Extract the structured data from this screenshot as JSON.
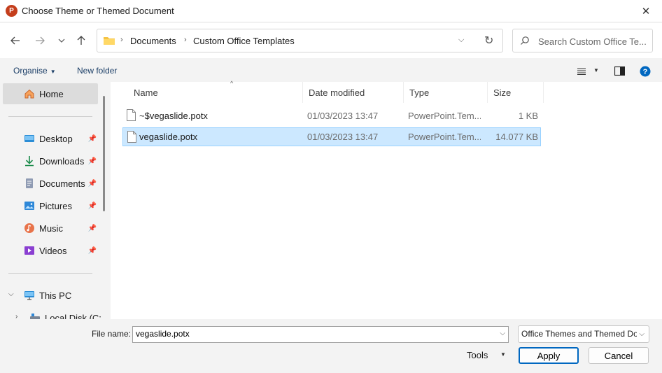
{
  "window": {
    "title": "Choose Theme or Themed Document",
    "app_icon_letter": "P",
    "close_glyph": "✕"
  },
  "address": {
    "crumbs": [
      "Documents",
      "Custom Office Templates"
    ]
  },
  "search": {
    "placeholder": "Search Custom Office Te..."
  },
  "toolbar": {
    "organise_label": "Organise",
    "new_folder_label": "New folder"
  },
  "sidebar": {
    "home": "Home",
    "quick_access": [
      {
        "label": "Desktop",
        "icon": "desktop-icon"
      },
      {
        "label": "Downloads",
        "icon": "download-icon"
      },
      {
        "label": "Documents",
        "icon": "documents-icon"
      },
      {
        "label": "Pictures",
        "icon": "pictures-icon"
      },
      {
        "label": "Music",
        "icon": "music-icon"
      },
      {
        "label": "Videos",
        "icon": "videos-icon"
      }
    ],
    "this_pc": "This PC",
    "local_disk": "Local Disk (C:"
  },
  "columns": {
    "name": "Name",
    "date": "Date modified",
    "type": "Type",
    "size": "Size"
  },
  "files": [
    {
      "name": "~$vegaslide.potx",
      "date": "01/03/2023 13:47",
      "type": "PowerPoint.Tem...",
      "size": "1 KB"
    },
    {
      "name": "vegaslide.potx",
      "date": "01/03/2023 13:47",
      "type": "PowerPoint.Tem...",
      "size": "14.077 KB"
    }
  ],
  "footer": {
    "file_name_label": "File name:",
    "file_name_value": "vegaslide.potx",
    "file_type": "Office Themes and Themed Do",
    "tools_label": "Tools",
    "apply_label": "Apply",
    "cancel_label": "Cancel"
  },
  "colors": {
    "accent": "#0067c0",
    "selection": "#cce8ff",
    "powerpoint": "#c43e1c"
  }
}
